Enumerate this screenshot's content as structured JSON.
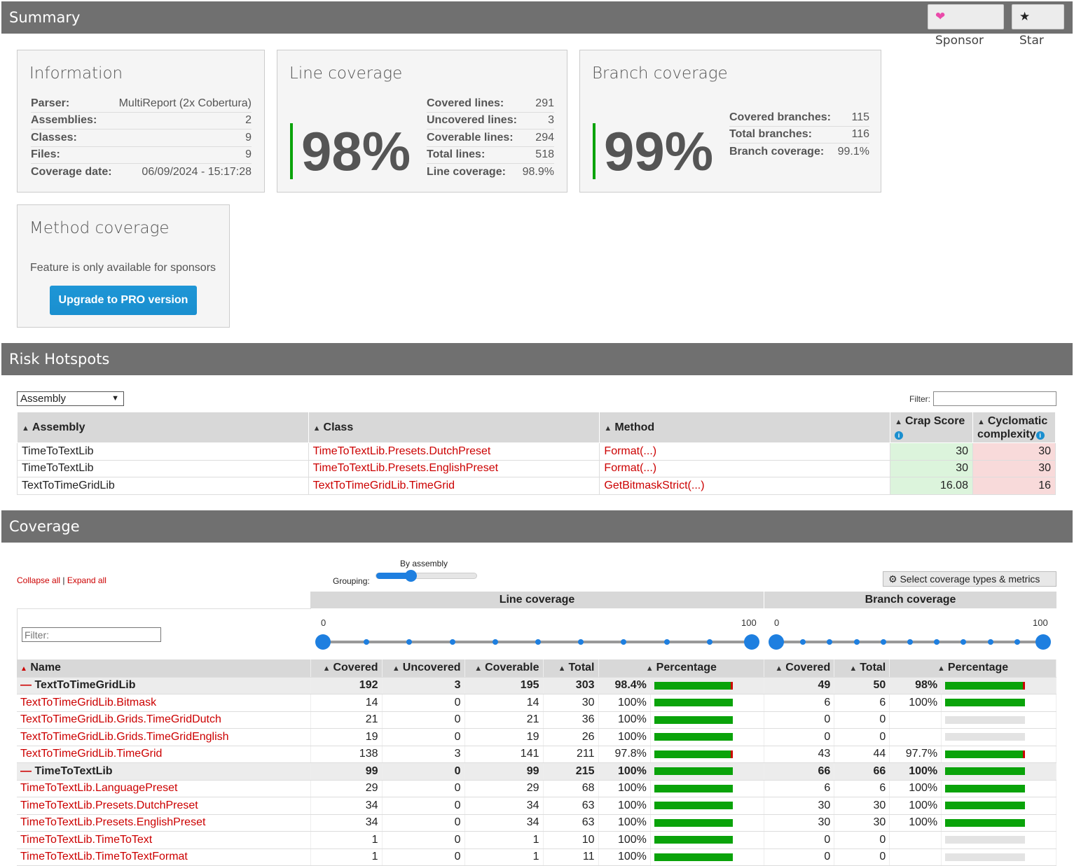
{
  "summary": {
    "title": "Summary",
    "sponsor_label": "Sponsor",
    "star_label": "Star"
  },
  "information": {
    "title": "Information",
    "rows": [
      {
        "k": "Parser:",
        "v": "MultiReport (2x Cobertura)"
      },
      {
        "k": "Assemblies:",
        "v": "2"
      },
      {
        "k": "Classes:",
        "v": "9"
      },
      {
        "k": "Files:",
        "v": "9"
      },
      {
        "k": "Coverage date:",
        "v": "06/09/2024 - 15:17:28"
      }
    ]
  },
  "line_coverage": {
    "title": "Line coverage",
    "big": "98%",
    "rows": [
      {
        "k": "Covered lines:",
        "v": "291"
      },
      {
        "k": "Uncovered lines:",
        "v": "3"
      },
      {
        "k": "Coverable lines:",
        "v": "294"
      },
      {
        "k": "Total lines:",
        "v": "518"
      },
      {
        "k": "Line coverage:",
        "v": "98.9%"
      }
    ]
  },
  "branch_coverage": {
    "title": "Branch coverage",
    "big": "99%",
    "rows": [
      {
        "k": "Covered branches:",
        "v": "115"
      },
      {
        "k": "Total branches:",
        "v": "116"
      },
      {
        "k": "Branch coverage:",
        "v": "99.1%"
      }
    ]
  },
  "method_coverage": {
    "title": "Method coverage",
    "note": "Feature is only available for sponsors",
    "button": "Upgrade to PRO version"
  },
  "risk": {
    "title": "Risk Hotspots",
    "select_value": "Assembly",
    "filter_label": "Filter:",
    "headers": {
      "assembly": "Assembly",
      "class": "Class",
      "method": "Method",
      "crap": "Crap Score",
      "cyclo1": "Cyclomatic",
      "cyclo2": "complexity"
    },
    "rows": [
      {
        "assembly": "TimeToTextLib",
        "class": "TimeToTextLib.Presets.DutchPreset",
        "method": "Format(...)",
        "crap": "30",
        "cyclo": "30"
      },
      {
        "assembly": "TimeToTextLib",
        "class": "TimeToTextLib.Presets.EnglishPreset",
        "method": "Format(...)",
        "crap": "30",
        "cyclo": "30"
      },
      {
        "assembly": "TextToTimeGridLib",
        "class": "TextToTimeGridLib.TimeGrid",
        "method": "GetBitmaskStrict(...)",
        "crap": "16.08",
        "cyclo": "16"
      }
    ]
  },
  "coverage": {
    "title": "Coverage",
    "collapse_all": "Collapse all",
    "separator": "|",
    "expand_all": "Expand all",
    "grouping_label": "Grouping:",
    "grouping_value": "By assembly",
    "select_types": "Select coverage types & metrics",
    "line_header": "Line coverage",
    "branch_header": "Branch coverage",
    "filter_placeholder": "Filter:",
    "slider_min": "0",
    "slider_max": "100",
    "cols": {
      "name": "Name",
      "covered": "Covered",
      "uncovered": "Uncovered",
      "coverable": "Coverable",
      "total": "Total",
      "percentage": "Percentage",
      "b_covered": "Covered",
      "b_total": "Total",
      "b_percentage": "Percentage"
    },
    "rows": [
      {
        "group": true,
        "name": "TextToTimeGridLib",
        "covered": "192",
        "uncovered": "3",
        "coverable": "195",
        "total": "303",
        "pct": "98.4%",
        "lfill": 98.4,
        "bcovered": "49",
        "btotal": "50",
        "bpct": "98%",
        "bfill": 98
      },
      {
        "group": false,
        "name": "TextToTimeGridLib.Bitmask",
        "covered": "14",
        "uncovered": "0",
        "coverable": "14",
        "total": "30",
        "pct": "100%",
        "lfill": 100,
        "bcovered": "6",
        "btotal": "6",
        "bpct": "100%",
        "bfill": 100
      },
      {
        "group": false,
        "name": "TextToTimeGridLib.Grids.TimeGridDutch",
        "covered": "21",
        "uncovered": "0",
        "coverable": "21",
        "total": "36",
        "pct": "100%",
        "lfill": 100,
        "bcovered": "0",
        "btotal": "0",
        "bpct": "",
        "bfill": null
      },
      {
        "group": false,
        "name": "TextToTimeGridLib.Grids.TimeGridEnglish",
        "covered": "19",
        "uncovered": "0",
        "coverable": "19",
        "total": "26",
        "pct": "100%",
        "lfill": 100,
        "bcovered": "0",
        "btotal": "0",
        "bpct": "",
        "bfill": null
      },
      {
        "group": false,
        "name": "TextToTimeGridLib.TimeGrid",
        "covered": "138",
        "uncovered": "3",
        "coverable": "141",
        "total": "211",
        "pct": "97.8%",
        "lfill": 97.8,
        "bcovered": "43",
        "btotal": "44",
        "bpct": "97.7%",
        "bfill": 97.7
      },
      {
        "group": true,
        "name": "TimeToTextLib",
        "covered": "99",
        "uncovered": "0",
        "coverable": "99",
        "total": "215",
        "pct": "100%",
        "lfill": 100,
        "bcovered": "66",
        "btotal": "66",
        "bpct": "100%",
        "bfill": 100
      },
      {
        "group": false,
        "name": "TimeToTextLib.LanguagePreset",
        "covered": "29",
        "uncovered": "0",
        "coverable": "29",
        "total": "68",
        "pct": "100%",
        "lfill": 100,
        "bcovered": "6",
        "btotal": "6",
        "bpct": "100%",
        "bfill": 100
      },
      {
        "group": false,
        "name": "TimeToTextLib.Presets.DutchPreset",
        "covered": "34",
        "uncovered": "0",
        "coverable": "34",
        "total": "63",
        "pct": "100%",
        "lfill": 100,
        "bcovered": "30",
        "btotal": "30",
        "bpct": "100%",
        "bfill": 100
      },
      {
        "group": false,
        "name": "TimeToTextLib.Presets.EnglishPreset",
        "covered": "34",
        "uncovered": "0",
        "coverable": "34",
        "total": "63",
        "pct": "100%",
        "lfill": 100,
        "bcovered": "30",
        "btotal": "30",
        "bpct": "100%",
        "bfill": 100
      },
      {
        "group": false,
        "name": "TimeToTextLib.TimeToText",
        "covered": "1",
        "uncovered": "0",
        "coverable": "1",
        "total": "10",
        "pct": "100%",
        "lfill": 100,
        "bcovered": "0",
        "btotal": "0",
        "bpct": "",
        "bfill": null
      },
      {
        "group": false,
        "name": "TimeToTextLib.TimeToTextFormat",
        "covered": "1",
        "uncovered": "0",
        "coverable": "1",
        "total": "11",
        "pct": "100%",
        "lfill": 100,
        "bcovered": "0",
        "btotal": "0",
        "bpct": "",
        "bfill": null
      }
    ]
  }
}
